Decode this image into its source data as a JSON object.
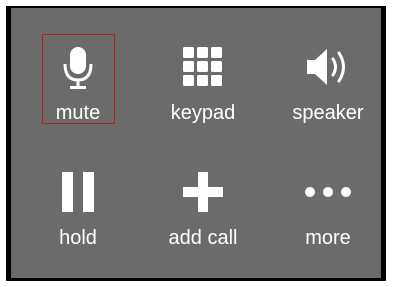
{
  "call_controls": {
    "buttons": [
      {
        "label": "mute",
        "icon": "microphone-icon",
        "selected": true
      },
      {
        "label": "keypad",
        "icon": "keypad-icon",
        "selected": false
      },
      {
        "label": "speaker",
        "icon": "speaker-icon",
        "selected": false
      },
      {
        "label": "hold",
        "icon": "pause-icon",
        "selected": false
      },
      {
        "label": "add call",
        "icon": "plus-icon",
        "selected": false
      },
      {
        "label": "more",
        "icon": "ellipsis-icon",
        "selected": false
      }
    ]
  },
  "colors": {
    "panel_background": "#6b6b6b",
    "frame_border": "#000000",
    "foreground": "#ffffff",
    "highlight_outline": "#b11f24"
  }
}
